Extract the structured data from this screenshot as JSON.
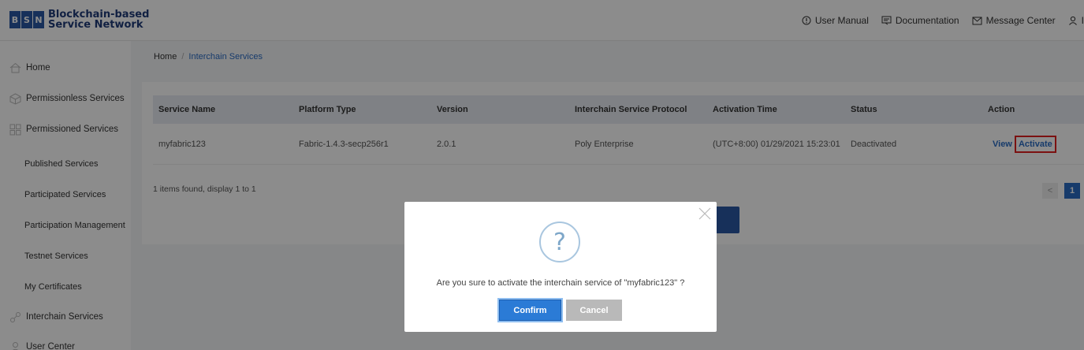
{
  "header": {
    "logo_letters": [
      "B",
      "S",
      "N"
    ],
    "logo_line1": "Blockchain-based",
    "logo_line2": "Service Network",
    "nav": {
      "user_manual": "User Manual",
      "documentation": "Documentation",
      "message_center": "Message Center",
      "user_partial": "I"
    }
  },
  "sidebar": {
    "items": [
      {
        "label": "Home",
        "icon": "home-icon"
      },
      {
        "label": "Permissionless Services",
        "icon": "cube-icon"
      },
      {
        "label": "Permissioned Services",
        "icon": "grid-icon"
      },
      {
        "label": "Published Services"
      },
      {
        "label": "Participated Services"
      },
      {
        "label": "Participation Management"
      },
      {
        "label": "Testnet Services"
      },
      {
        "label": "My Certificates"
      },
      {
        "label": "Interchain Services",
        "icon": "interchain-icon"
      },
      {
        "label": "User Center",
        "icon": "user-icon"
      }
    ]
  },
  "breadcrumb": {
    "home": "Home",
    "sep": "/",
    "current": "Interchain Services"
  },
  "table": {
    "headers": [
      "Service Name",
      "Platform Type",
      "Version",
      "Interchain Service Protocol",
      "Activation Time",
      "Status",
      "Action"
    ],
    "rows": [
      {
        "service_name": "myfabric123",
        "platform_type": "Fabric-1.4.3-secp256r1",
        "version": "2.0.1",
        "protocol": "Poly Enterprise",
        "activation_time": "(UTC+8:00) 01/29/2021 15:23:01",
        "status": "Deactivated",
        "action_view": "View",
        "action_activate": "Activate"
      }
    ],
    "found_text": "1 items found, display 1 to 1",
    "pager_prev": "<",
    "current_page": "1"
  },
  "modal": {
    "icon_symbol": "?",
    "message": "Are you sure to activate the interchain service of \"myfabric123\" ?",
    "confirm_label": "Confirm",
    "cancel_label": "Cancel"
  },
  "colors": {
    "brand": "#2b58a5",
    "link": "#2b6cc4",
    "highlight": "#e02020",
    "confirm": "#2b7bd6",
    "cancel": "#b9b9b9"
  }
}
